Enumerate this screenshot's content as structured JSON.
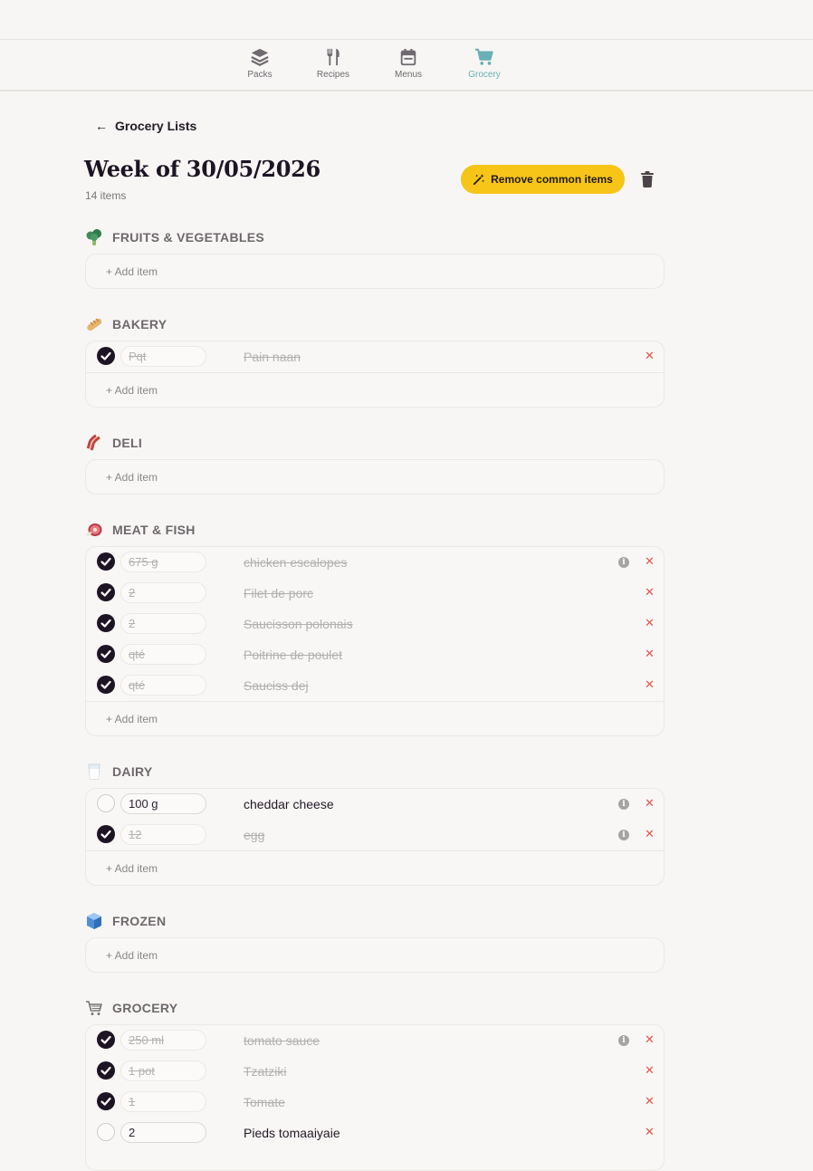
{
  "nav": {
    "items": [
      {
        "label": "Packs",
        "icon": "layers-icon"
      },
      {
        "label": "Recipes",
        "icon": "fork-knife-icon"
      },
      {
        "label": "Menus",
        "icon": "calendar-icon"
      },
      {
        "label": "Grocery",
        "icon": "cart-icon"
      }
    ],
    "active": "Grocery",
    "active_color": "#6aafb4"
  },
  "header": {
    "back_label": "Grocery Lists",
    "title": "Week of 30/05/2026",
    "count": "14 items",
    "remove_label": "Remove common items",
    "accent": "#f6c518"
  },
  "add_label": "+ Add item",
  "sections": {
    "fruits": {
      "title": "FRUITS & VEGETABLES",
      "emoji": "broccoli-icon"
    },
    "bakery": {
      "title": "BAKERY",
      "emoji": "baguette-icon",
      "items": [
        {
          "qty": "",
          "placeholder": "Pqt",
          "name": "Pain naan",
          "done": true
        }
      ]
    },
    "deli": {
      "title": "DELI",
      "emoji": "bacon-icon"
    },
    "meat": {
      "title": "MEAT & FISH",
      "emoji": "meat-icon",
      "items": [
        {
          "qty": "675 g",
          "name": "chicken escalopes",
          "done": true,
          "info": true
        },
        {
          "qty": "2",
          "name": "Filet de porc",
          "done": true
        },
        {
          "qty": "2",
          "name": "Saucisson polonais",
          "done": true
        },
        {
          "qty": "",
          "placeholder": "qté",
          "name": "Poitrine de poulet",
          "done": true
        },
        {
          "qty": "",
          "placeholder": "qté",
          "name": "Sauciss dej",
          "done": true
        }
      ]
    },
    "dairy": {
      "title": "DAIRY",
      "emoji": "milk-glass-icon",
      "items": [
        {
          "qty": "100 g",
          "name": "cheddar cheese",
          "done": false,
          "info": true
        },
        {
          "qty": "12",
          "name": "egg",
          "done": true,
          "info": true
        }
      ]
    },
    "frozen": {
      "title": "FROZEN",
      "emoji": "ice-cube-icon"
    },
    "grocery": {
      "title": "GROCERY",
      "emoji": "shopping-cart-icon",
      "items": [
        {
          "qty": "250 ml",
          "name": "tomato sauce",
          "done": true,
          "info": true
        },
        {
          "qty": "1 pot",
          "name": "Tzatziki",
          "done": true
        },
        {
          "qty": "1",
          "name": "Tomate",
          "done": true
        },
        {
          "qty": "2",
          "name": "Pieds tomaaiyaie",
          "done": false
        }
      ]
    }
  },
  "colors": {
    "check_on": "#1d1424",
    "delete": "#e2564f",
    "info": "#a7a3a4"
  }
}
